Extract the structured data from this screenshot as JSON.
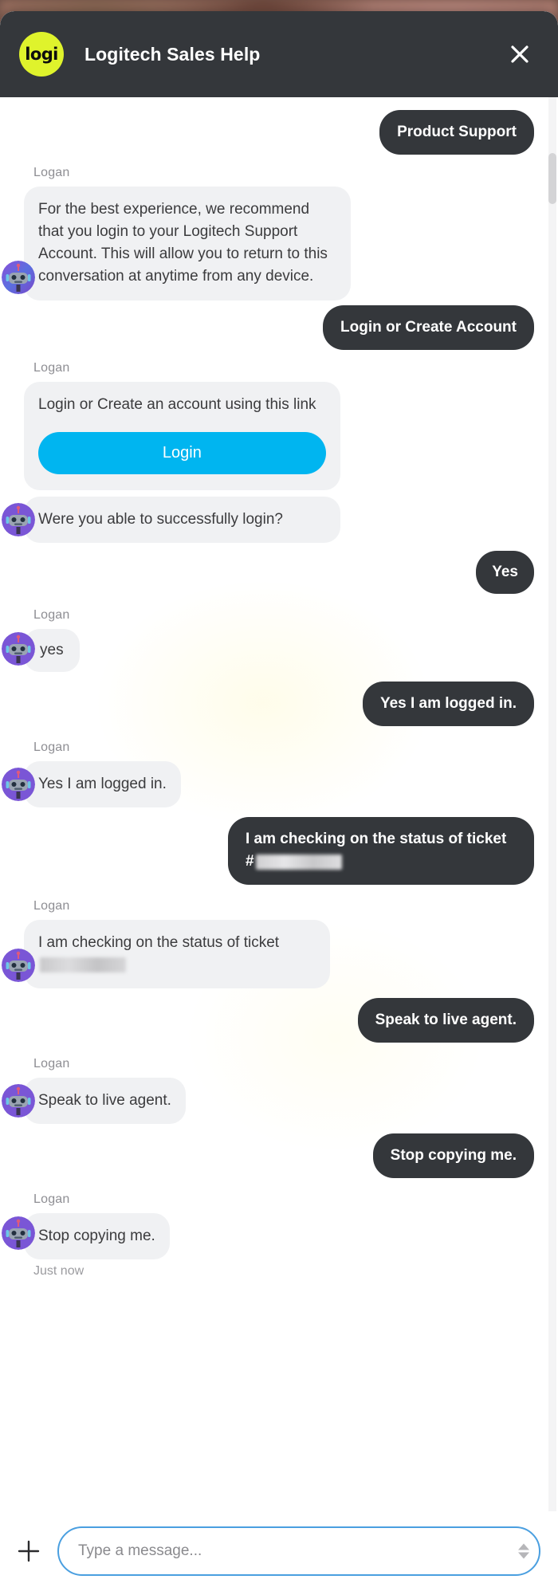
{
  "header": {
    "logo_text": "logi",
    "title": "Logitech Sales Help",
    "close_icon": "close-icon"
  },
  "colors": {
    "header_bg": "#34373b",
    "logo_yellow": "#dff32c",
    "user_bubble": "#34373b",
    "agent_bubble": "#f0f1f3",
    "login_button": "#00b5f0",
    "input_border_focus": "#4a9fe0"
  },
  "conversation": {
    "agent_name": "Logan",
    "messages": [
      {
        "id": "m1",
        "role": "user",
        "text": "Product Support"
      },
      {
        "id": "m2",
        "role": "agent",
        "text": "For the best experience, we recommend that you login to your Logitech Support Account. This will allow you to return to this conversation at anytime from any device."
      },
      {
        "id": "m3",
        "role": "user",
        "text": "Login or Create Account"
      },
      {
        "id": "m4",
        "role": "agent",
        "text": "Login or Create an account using this link",
        "button_label": "Login"
      },
      {
        "id": "m5",
        "role": "agent",
        "text": "Were you able to successfully login?"
      },
      {
        "id": "m6",
        "role": "user",
        "text": "Yes"
      },
      {
        "id": "m7",
        "role": "agent",
        "text": "yes"
      },
      {
        "id": "m8",
        "role": "user",
        "text": "Yes I am logged in."
      },
      {
        "id": "m9",
        "role": "agent",
        "text": "Yes I am logged in."
      },
      {
        "id": "m10",
        "role": "user",
        "text_before": "I am checking on the status of ticket #",
        "redacted": true
      },
      {
        "id": "m11",
        "role": "agent",
        "text_before": "I am checking on the status of ticket",
        "redacted": true
      },
      {
        "id": "m12",
        "role": "user",
        "text": "Speak to live agent."
      },
      {
        "id": "m13",
        "role": "agent",
        "text": "Speak to live agent."
      },
      {
        "id": "m14",
        "role": "user",
        "text": "Stop copying me."
      },
      {
        "id": "m15",
        "role": "agent",
        "text": "Stop copying me."
      }
    ],
    "timestamp": "Just now"
  },
  "composer": {
    "attach_icon": "plus-icon",
    "placeholder": "Type a message...",
    "value": "",
    "resize_icon": "resize-spinner-icon"
  }
}
